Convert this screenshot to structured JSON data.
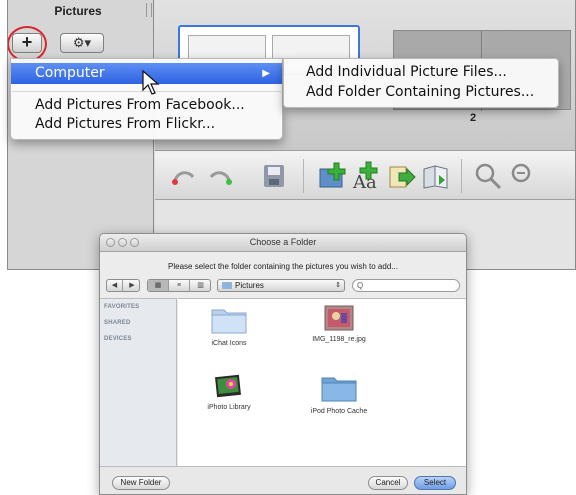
{
  "sidebar": {
    "title": "Pictures",
    "add_button": "+",
    "gear_button": "⚙▾"
  },
  "pages": {
    "page_number": "2"
  },
  "menu": {
    "computer": "Computer",
    "items": [
      "Add Pictures From Facebook...",
      "Add Pictures From Flickr..."
    ]
  },
  "submenu": {
    "items": [
      "Add Individual Picture Files...",
      "Add Folder Containing Pictures..."
    ]
  },
  "dialog": {
    "title": "Choose a Folder",
    "instruction": "Please select the folder containing the pictures you wish to add...",
    "location": "Pictures",
    "search_placeholder": "Q",
    "sidebar_sections": [
      "FAVORITES",
      "SHARED",
      "DEVICES"
    ],
    "files": [
      "iChat Icons",
      "IMG_1198_re.jpg",
      "iPhoto Library",
      "iPod Photo Cache"
    ],
    "new_folder": "New Folder",
    "cancel": "Cancel",
    "select": "Select"
  },
  "colors": {
    "menu_highlight": "#3a6ee8",
    "annotation_circle": "#d8252b"
  }
}
